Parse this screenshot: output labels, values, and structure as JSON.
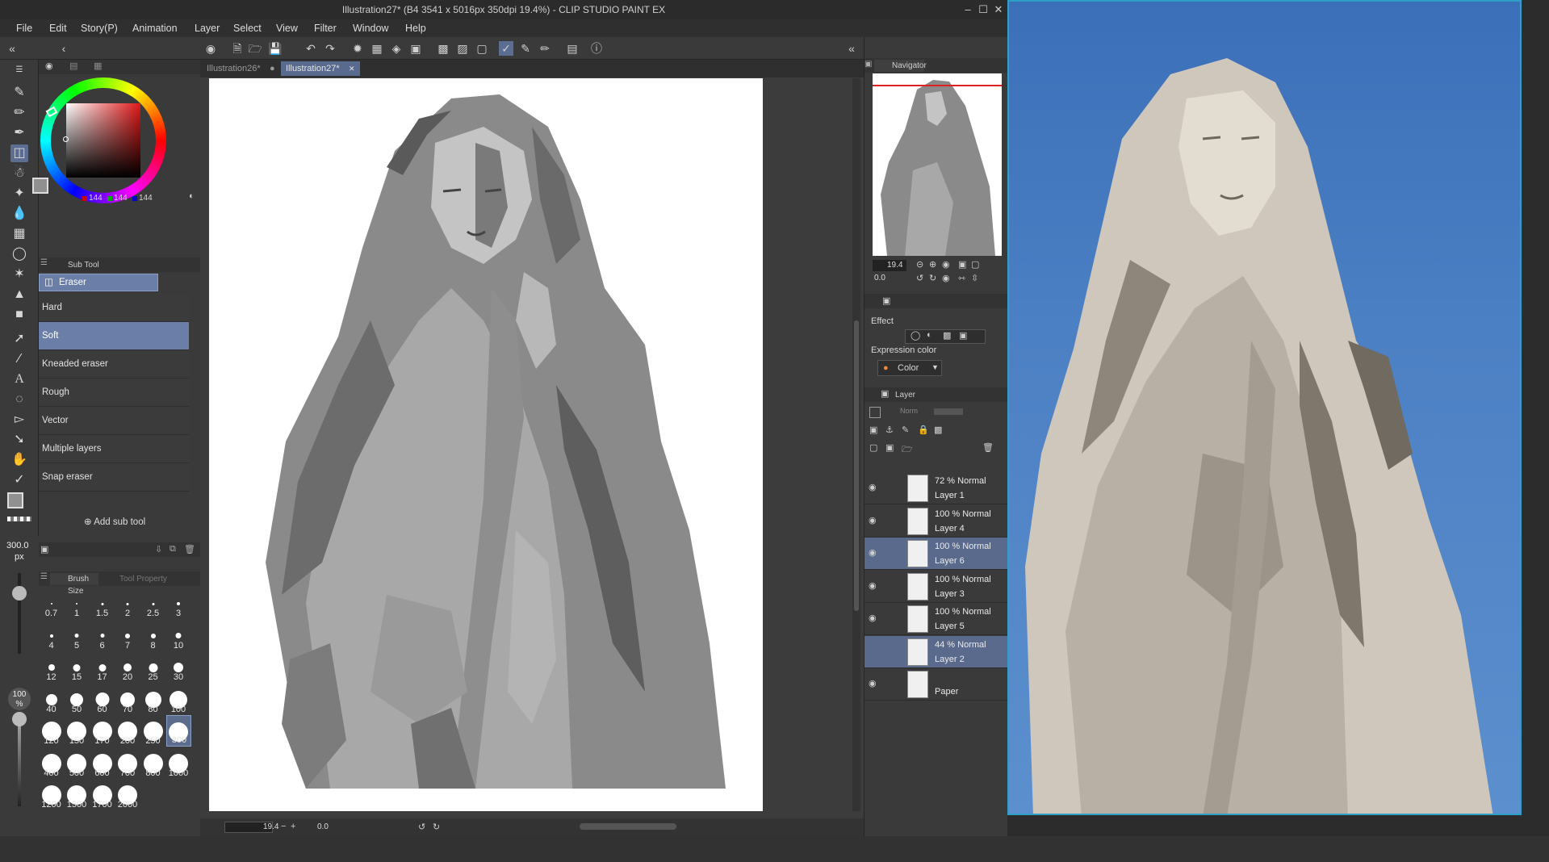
{
  "window": {
    "title": "Illustration27* (B4 3541 x 5016px 350dpi 19.4%) - CLIP STUDIO PAINT EX"
  },
  "menu": [
    "File",
    "Edit",
    "Story(P)",
    "Animation",
    "Layer",
    "Select",
    "View",
    "Filter",
    "Window",
    "Help"
  ],
  "color": {
    "rgb": [
      "144",
      "144",
      "144"
    ],
    "main": "#909090",
    "sub": "#3548a0"
  },
  "subtool_panel": {
    "tab": "Sub Tool",
    "group": "Eraser",
    "items": [
      "Hard",
      "Soft",
      "Kneaded eraser",
      "Rough",
      "Vector",
      "Multiple layers",
      "Snap eraser"
    ],
    "selected": "Soft",
    "add_label": "Add sub tool"
  },
  "brush_size": {
    "current": "300.0",
    "unit": "px",
    "opacity": "100",
    "opacity_unit": "%",
    "tab_brush": "Brush Size",
    "tab_prop": "Tool Property",
    "sizes": [
      "0.7",
      "1",
      "1.5",
      "2",
      "2.5",
      "3",
      "4",
      "5",
      "6",
      "7",
      "8",
      "10",
      "12",
      "15",
      "17",
      "20",
      "25",
      "30",
      "40",
      "50",
      "60",
      "70",
      "80",
      "100",
      "120",
      "150",
      "170",
      "200",
      "250",
      "300",
      "400",
      "500",
      "600",
      "700",
      "800",
      "1000",
      "1200",
      "1500",
      "1700",
      "2000"
    ],
    "selected": "300"
  },
  "documents": {
    "tabs": [
      "Illustration26*",
      "Illustration27*"
    ],
    "active": "Illustration27*",
    "zoom": "19.4",
    "rotation": "0.0"
  },
  "navigator": {
    "tab": "Navigator",
    "zoom": "19.4",
    "rotation": "0.0"
  },
  "effect_panel": {
    "effect_label": "Effect",
    "expression_label": "Expression color",
    "expression_value": "Color"
  },
  "layer_panel": {
    "tab": "Layer",
    "blend": "Norm",
    "layers": [
      {
        "mode": "72 % Normal",
        "name": "Layer 1",
        "selected": false,
        "visible": true
      },
      {
        "mode": "100 % Normal",
        "name": "Layer 4",
        "selected": false,
        "visible": true
      },
      {
        "mode": "100 % Normal",
        "name": "Layer 6",
        "selected": true,
        "visible": true
      },
      {
        "mode": "100 % Normal",
        "name": "Layer 3",
        "selected": false,
        "visible": true
      },
      {
        "mode": "100 % Normal",
        "name": "Layer 5",
        "selected": false,
        "visible": true
      },
      {
        "mode": "44 % Normal",
        "name": "Layer 2",
        "selected": true,
        "visible": false
      },
      {
        "mode": "",
        "name": "Paper",
        "selected": false,
        "visible": true
      }
    ]
  }
}
